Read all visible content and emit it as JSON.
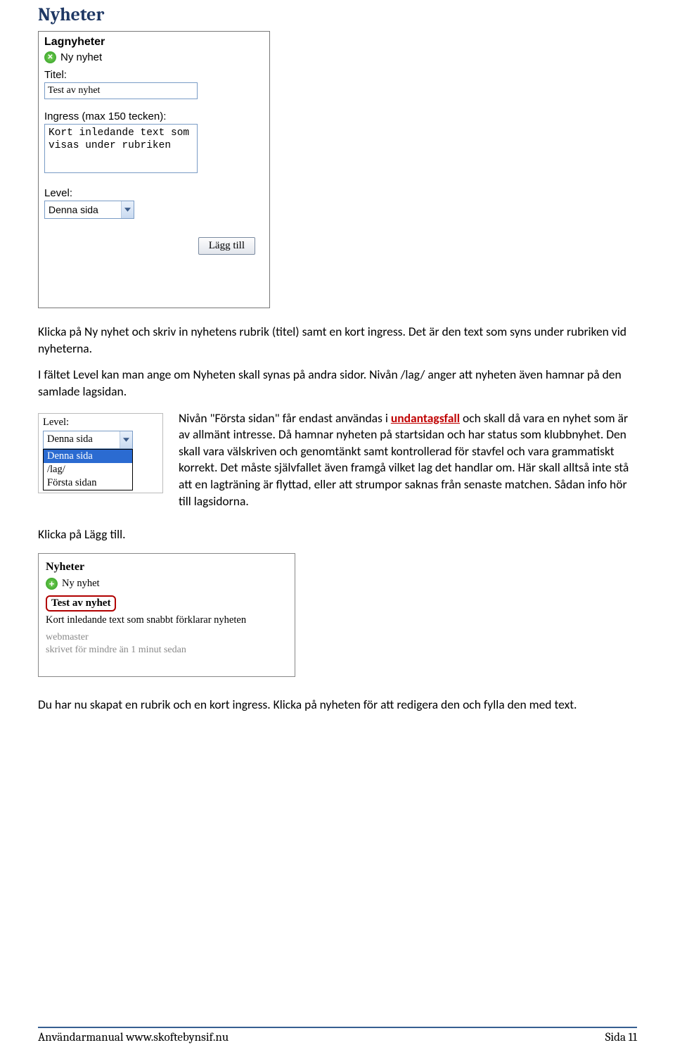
{
  "heading": "Nyheter",
  "widget1": {
    "title": "Lagnyheter",
    "newLink": "Ny nyhet",
    "titelLabel": "Titel:",
    "titelValue": "Test av nyhet",
    "ingressLabel": "Ingress (max 150 tecken):",
    "ingressValue": "Kort inledande text som visas under rubriken",
    "levelLabel": "Level:",
    "levelSelected": "Denna sida",
    "addBtn": "Lägg till"
  },
  "para1": "Klicka på Ny nyhet och skriv in nyhetens rubrik (titel) samt en kort ingress. Det är den text som syns under rubriken vid nyheterna.",
  "para2a": "I fältet Level kan man ange om Nyheten skall synas på andra sidor. Nivån /lag/ anger att nyheten även hamnar på den samlade lagsidan.",
  "levelDropdown": {
    "label": "Level:",
    "selected": "Denna sida",
    "options": [
      "Denna sida",
      "/lag/",
      "Första sidan"
    ]
  },
  "para3_pre": "Nivån \"Första sidan\" får endast användas i ",
  "para3_red": "undantagsfall",
  "para3_post": " och skall då vara en nyhet som är av allmänt intresse. Då hamnar nyheten på startsidan och har status som klubbnyhet. Den skall vara välskriven och genomtänkt samt kontrollerad för stavfel och vara grammatiskt korrekt. Det måste självfallet även framgå vilket lag det handlar om. Här skall alltså inte stå att en lagträning är flyttad, eller att strumpor saknas från senaste matchen. Sådan info hör till lagsidorna.",
  "para4": "Klicka på Lägg till.",
  "widget2": {
    "heading": "Nyheter",
    "newLink": "Ny nyhet",
    "nTitle": "Test av nyhet",
    "nIngress": "Kort inledande text som snabbt förklarar nyheten",
    "meta1": "webmaster",
    "meta2": "skrivet för mindre än 1 minut sedan"
  },
  "para5": "Du har nu skapat en rubrik och en kort ingress. Klicka på nyheten för att redigera den och fylla den med text.",
  "footer": {
    "left": "Användarmanual www.skoftebynsif.nu",
    "right": "Sida 11"
  }
}
